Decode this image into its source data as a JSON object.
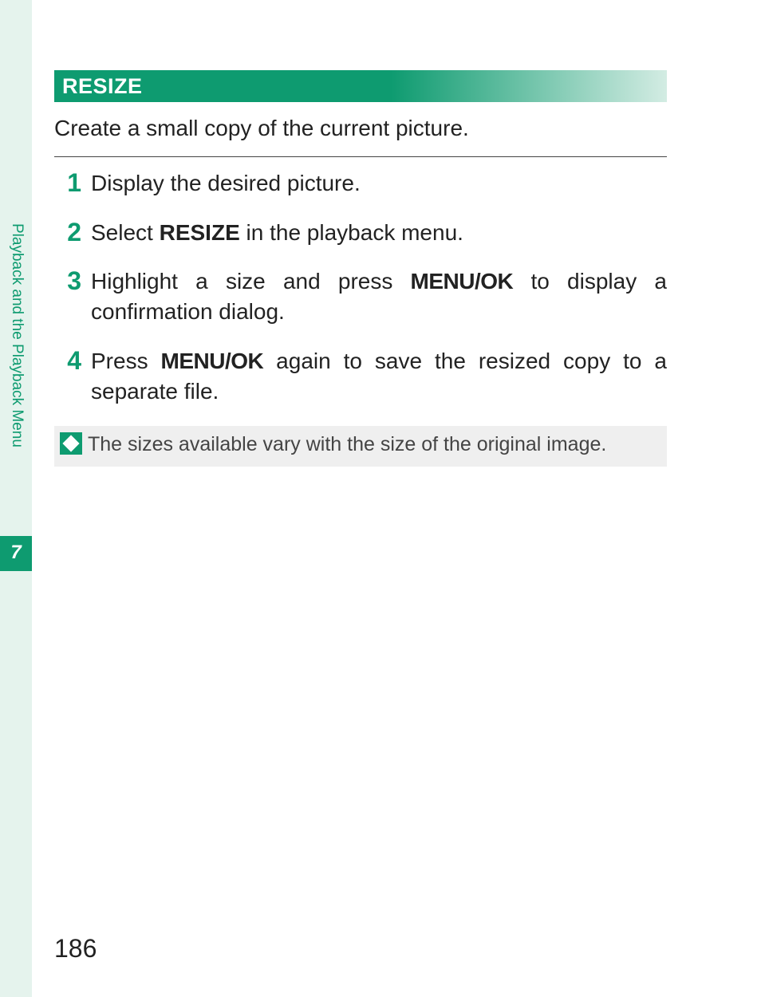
{
  "sidebar": {
    "section_title": "Playback and the Playback Menu",
    "chapter_number": "7"
  },
  "heading": "RESIZE",
  "intro": "Create a small copy of the current picture.",
  "steps": [
    {
      "n": "1",
      "html": "Display the desired picture."
    },
    {
      "n": "2",
      "html": "Select <b>RESIZE</b> in the playback menu."
    },
    {
      "n": "3",
      "html": "Highlight a size and press <span class=\"cond\">MENU/OK</span> to display a confirmation dialog."
    },
    {
      "n": "4",
      "html": "Press <span class=\"cond\">MENU/OK</span> again to save the resized copy to a separate file."
    }
  ],
  "note": "The sizes available vary with the size of the original image.",
  "page_number": "186"
}
